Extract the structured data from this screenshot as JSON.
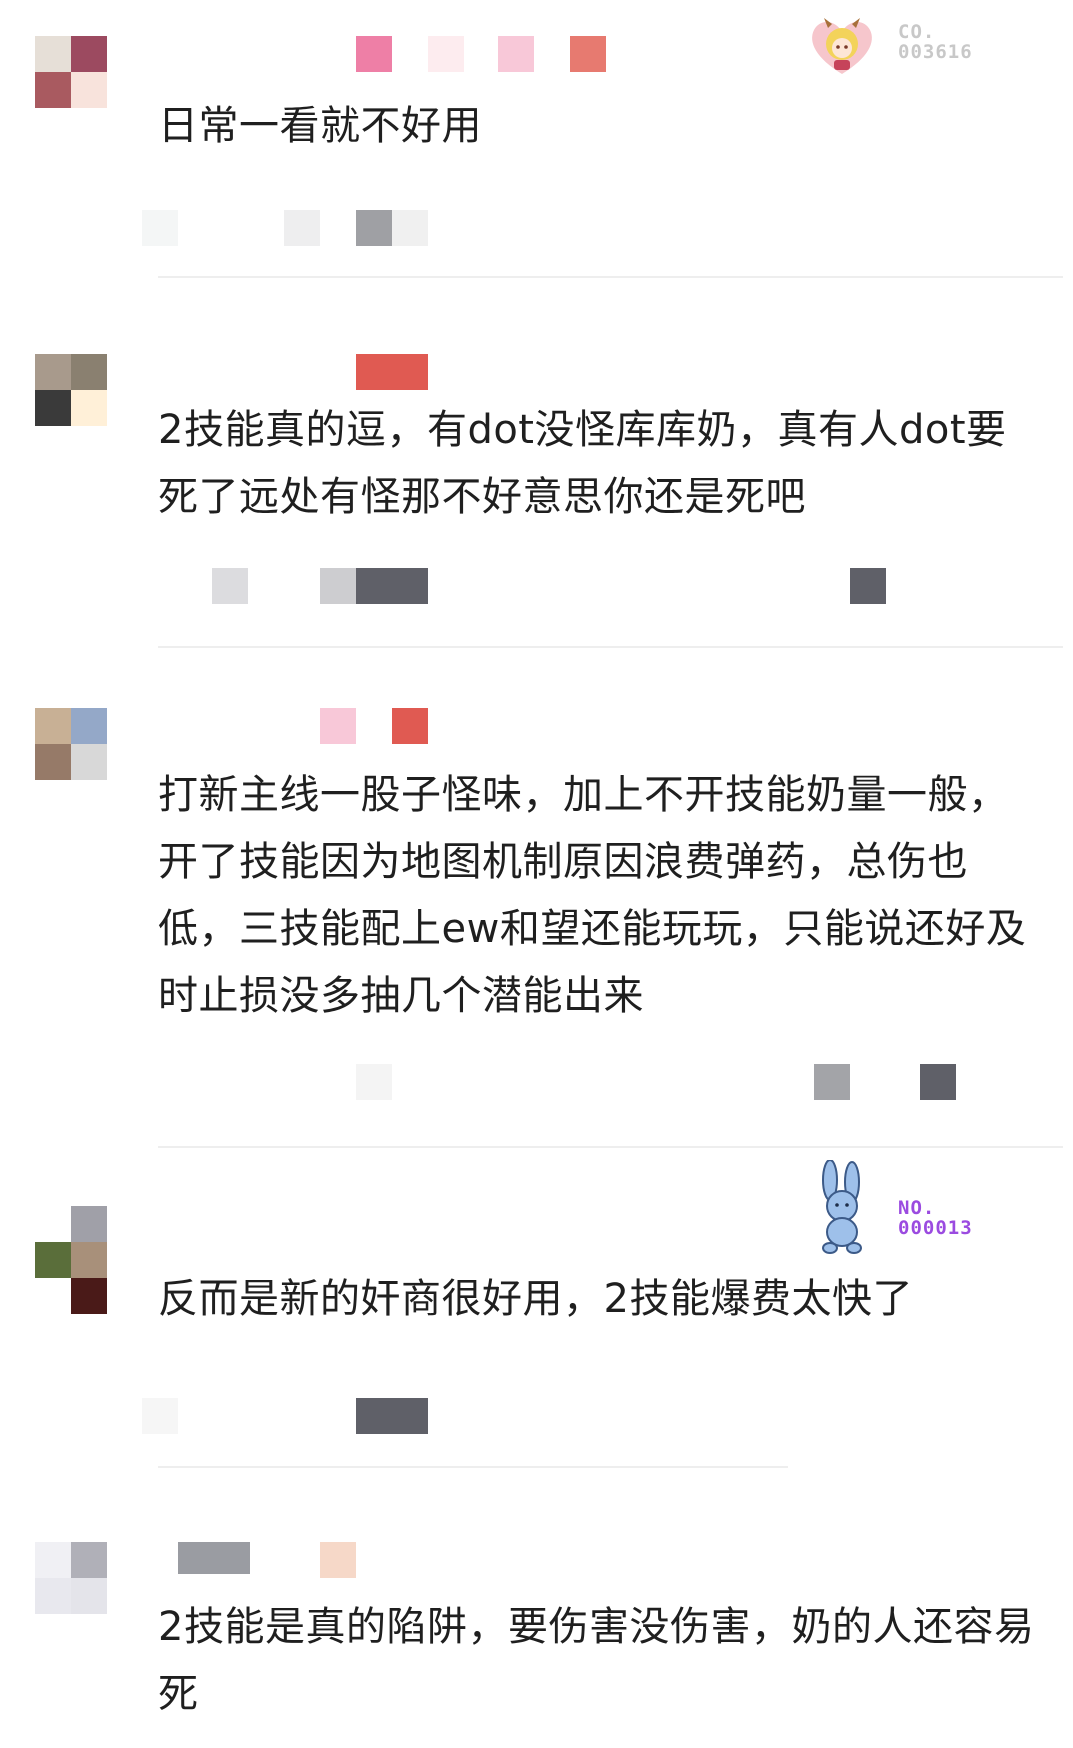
{
  "comments": [
    {
      "text": "日常一看就不好用",
      "avatar_colors": [
        "#e6dfd7",
        "#9c4a60",
        "#a95a60",
        "#f8e3dc"
      ],
      "badge": {
        "line1": "CO.",
        "line2": "003616",
        "color": "#c8c8c8"
      }
    },
    {
      "text": "2技能真的逗，有dot没怪库库奶，真有人dot要死了远处有怪那不好意思你还是死吧",
      "avatar_colors": [
        "#a89a8c",
        "#8a8070",
        "#3a3a3a",
        "#fff0d8"
      ]
    },
    {
      "text": "打新主线一股子怪味，加上不开技能奶量一般，开了技能因为地图机制原因浪费弹药，总伤也低，三技能配上ew和望还能玩玩，只能说还好及时止损没多抽几个潜能出来",
      "avatar_colors": [
        "#c8b095",
        "#94a8c8",
        "#967a68",
        "#d8d8d8"
      ]
    },
    {
      "text": "反而是新的奸商很好用，2技能爆费太快了",
      "avatar_colors": [
        "#ffffff",
        "#a0a0a8",
        "#5a6e3a",
        "#a8907a",
        "#ffffff",
        "#4a1a18"
      ],
      "badge": {
        "line1": "NO.",
        "line2": "000013",
        "color": "#9b4be0"
      }
    },
    {
      "text": "2技能是真的陷阱，要伤害没伤害，奶的人还容易死",
      "avatar_colors": [
        "#f0f0f4",
        "#b0b0b8",
        "#e8e8ee",
        "#e4e4ea"
      ]
    }
  ],
  "colors": {
    "pink": "#ee7fa6",
    "red": "#e05a52",
    "gray_dark": "#5f6068",
    "gray_mid": "#a3a4a8",
    "gray_light": "#dcdcdf"
  }
}
